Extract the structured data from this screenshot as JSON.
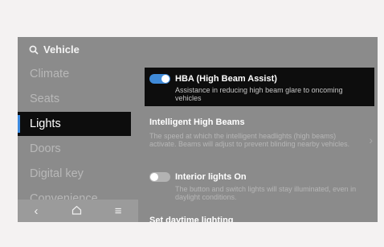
{
  "search": {
    "label": "Vehicle"
  },
  "sidebar": {
    "items": [
      {
        "label": "Climate",
        "active": false
      },
      {
        "label": "Seats",
        "active": false
      },
      {
        "label": "Lights",
        "active": true
      },
      {
        "label": "Doors",
        "active": false
      },
      {
        "label": "Digital key",
        "active": false
      },
      {
        "label": "Convenience",
        "active": false
      }
    ]
  },
  "navbar": {
    "back": "back-icon",
    "home": "home-icon",
    "menu": "menu-icon"
  },
  "settings": {
    "hba": {
      "title": "HBA (High Beam Assist)",
      "description": "Assistance in reducing high beam glare to oncoming vehicles",
      "enabled": true
    },
    "intelligent": {
      "title": "Intelligent High Beams",
      "description": "The speed at which the intelligent headlights (high beams) activate. Beams will adjust to prevent blinding nearby vehicles."
    },
    "interior": {
      "title": "Interior lights On",
      "description": "The button and switch lights will stay illuminated, even in daylight conditions.",
      "enabled": false
    },
    "daytime": {
      "title": "Set daytime lighting"
    }
  },
  "colors": {
    "accent": "#3f8ad8",
    "panel": "#8b8b8b",
    "highlight": "#0d0d0d"
  }
}
